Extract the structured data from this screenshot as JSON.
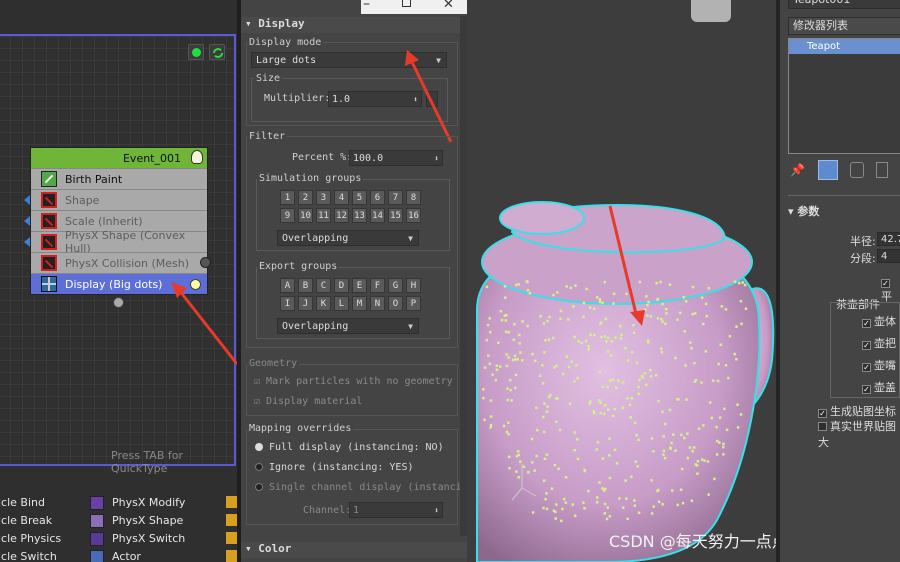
{
  "node_editor": {
    "node_title": "Event_001",
    "operators": [
      {
        "label": "Birth Paint",
        "state": "active"
      },
      {
        "label": "Shape",
        "state": "disabled"
      },
      {
        "label": "Scale (Inherit)",
        "state": "disabled"
      },
      {
        "label": "PhysX Shape (Convex Hull)",
        "state": "disabled"
      },
      {
        "label": "PhysX Collision (Mesh)",
        "state": "disabled"
      },
      {
        "label": "Display (Big dots)",
        "state": "selected"
      }
    ],
    "quicktab_hint": "Press TAB for QuickType",
    "depot_col1": [
      "icle Bind",
      "icle Break",
      "icle Physics",
      "icle Switch"
    ],
    "depot_col2": [
      "PhysX Modify",
      "PhysX Shape",
      "PhysX Switch",
      "Actor"
    ]
  },
  "rollout": {
    "display_header": "Display",
    "display_mode_label": "Display mode",
    "display_mode_value": "Large dots",
    "size_label": "Size",
    "multiplier_label": "Multiplier:",
    "multiplier_value": "1.0",
    "filter_label": "Filter",
    "percent_label": "Percent %:",
    "percent_value": "100.0",
    "simulation_groups_label": "Simulation groups",
    "sim_numbers": [
      "1",
      "2",
      "3",
      "4",
      "5",
      "6",
      "7",
      "8",
      "9",
      "10",
      "11",
      "12",
      "13",
      "14",
      "15",
      "16"
    ],
    "sim_dropdown": "Overlapping",
    "export_groups_label": "Export groups",
    "export_letters": [
      "A",
      "B",
      "C",
      "D",
      "E",
      "F",
      "G",
      "H",
      "I",
      "J",
      "K",
      "L",
      "M",
      "N",
      "O",
      "P"
    ],
    "export_dropdown": "Overlapping",
    "geometry_label": "Geometry",
    "geo_check1": "Mark particles with no geometry",
    "geo_check2": "Display material",
    "mapping_label": "Mapping overrides",
    "radio1": "Full display (instancing: NO)",
    "radio2": "Ignore (instancing: YES)",
    "radio3": "Single channel display (instancin",
    "channel_label": "Channel:",
    "channel_value": "1",
    "color_header": "Color"
  },
  "right_panel": {
    "top_field": "Teapot001",
    "modifier_list": "修改器列表",
    "stack_item": "Teapot",
    "params_header": "参数",
    "radius_label": "半径:",
    "radius_value": "42.7",
    "segments_label": "分段:",
    "segments_value": "4",
    "smooth_label": "平",
    "parts_label": "茶壶部件",
    "parts": [
      "壶体",
      "壶把",
      "壶嘴",
      "壶盖"
    ],
    "gen_map": "生成贴图坐标",
    "real_world": "真实世界贴图大"
  },
  "watermark": "CSDN @每天努力一点点，哈哈",
  "colors": {
    "selected_op": "#5d6fd6",
    "node_header": "#6fb538",
    "teapot": "#c79cc7",
    "selection_outline": "#38e0e8",
    "particles": "#d4f08a",
    "arrow": "#e83a2a"
  }
}
